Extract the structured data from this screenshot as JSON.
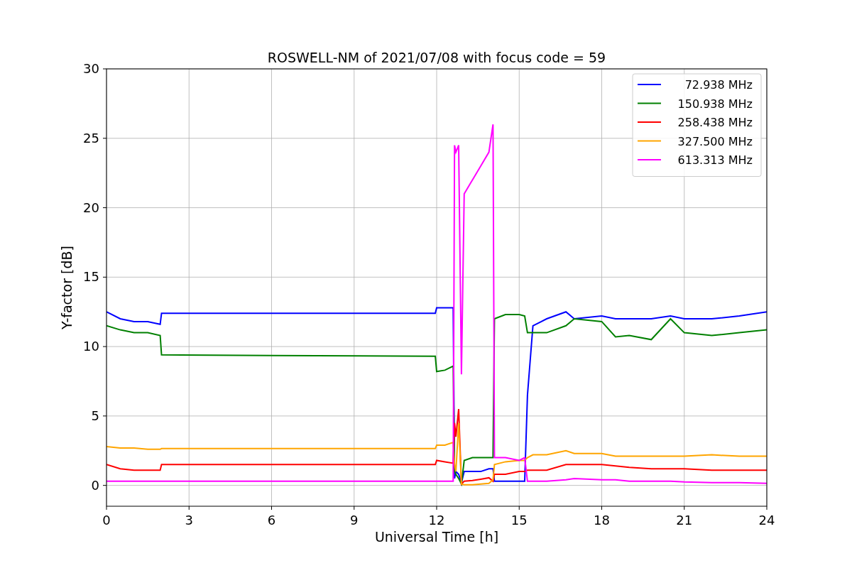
{
  "figure": {
    "chart_data": {
      "type": "line",
      "title": "ROSWELL-NM of 2021/07/08 with focus code = 59",
      "xlabel": "Universal Time [h]",
      "ylabel": "Y-factor [dB]",
      "x": [
        0,
        0.5,
        1,
        1.5,
        1.95,
        2,
        6,
        11.95,
        12,
        12.3,
        12.6,
        12.65,
        12.7,
        12.8,
        12.9,
        13,
        13.3,
        13.6,
        13.9,
        14.05,
        14.1,
        14.5,
        15,
        15.2,
        15.3,
        15.5,
        16,
        16.7,
        17,
        18,
        18.5,
        19,
        19.8,
        20.5,
        21,
        22,
        23,
        24
      ],
      "series": [
        {
          "name": "72.938 MHz",
          "color": "#0000ff",
          "values": [
            12.5,
            12,
            11.8,
            11.8,
            11.6,
            12.4,
            12.4,
            12.4,
            12.8,
            12.8,
            12.8,
            0.5,
            1,
            0.8,
            0.2,
            1,
            1,
            1,
            1.2,
            1.2,
            0.3,
            0.3,
            0.3,
            0.3,
            6.5,
            11.5,
            12,
            12.5,
            12,
            12.2,
            12,
            12,
            12,
            12.2,
            12,
            12,
            12.2,
            12.5
          ]
        },
        {
          "name": "150.938 MHz",
          "color": "#008000",
          "values": [
            11.5,
            11.2,
            11,
            11,
            10.8,
            9.4,
            9.35,
            9.3,
            8.2,
            8.3,
            8.6,
            1,
            0.8,
            0.5,
            0.1,
            1.8,
            2,
            2,
            2,
            2,
            12,
            12.3,
            12.3,
            12.2,
            11,
            11,
            11,
            11.5,
            12,
            11.8,
            10.7,
            10.8,
            10.5,
            12,
            11,
            10.8,
            11,
            11.2
          ]
        },
        {
          "name": "258.438 MHz",
          "color": "#ff0000",
          "values": [
            1.5,
            1.2,
            1.1,
            1.1,
            1.1,
            1.5,
            1.5,
            1.5,
            1.8,
            1.7,
            1.6,
            4.5,
            3.5,
            5.5,
            0.1,
            0.3,
            0.35,
            0.45,
            0.55,
            0.3,
            0.8,
            0.8,
            1,
            1,
            1.1,
            1.1,
            1.1,
            1.5,
            1.5,
            1.5,
            1.4,
            1.3,
            1.2,
            1.2,
            1.2,
            1.1,
            1.1,
            1.1
          ]
        },
        {
          "name": "327.500 MHz",
          "color": "#ffa500",
          "values": [
            2.8,
            2.7,
            2.7,
            2.6,
            2.6,
            2.65,
            2.65,
            2.65,
            2.9,
            2.9,
            3.1,
            1.5,
            1,
            4.5,
            0.1,
            0.05,
            0.05,
            0.1,
            0.15,
            0.4,
            1.5,
            1.7,
            1.8,
            1.8,
            2,
            2.2,
            2.2,
            2.5,
            2.3,
            2.3,
            2.1,
            2.1,
            2.1,
            2.1,
            2.1,
            2.2,
            2.1,
            2.1
          ]
        },
        {
          "name": "613.313 MHz",
          "color": "#ff00ff",
          "values": [
            0.3,
            0.3,
            0.3,
            0.3,
            0.3,
            0.3,
            0.3,
            0.3,
            0.3,
            0.3,
            0.3,
            24.5,
            24,
            24.5,
            8,
            21,
            22,
            23,
            24,
            26,
            2,
            2,
            1.8,
            2,
            0.3,
            0.3,
            0.3,
            0.4,
            0.5,
            0.4,
            0.4,
            0.3,
            0.3,
            0.3,
            0.25,
            0.2,
            0.2,
            0.15
          ]
        }
      ],
      "grid": true,
      "legend": true,
      "xlim": [
        0,
        24
      ],
      "ylim": [
        -1.5,
        30
      ],
      "xticks": [
        0,
        3,
        6,
        9,
        12,
        15,
        18,
        21,
        24
      ],
      "yticks": [
        0,
        5,
        10,
        15,
        20,
        25,
        30
      ]
    }
  }
}
